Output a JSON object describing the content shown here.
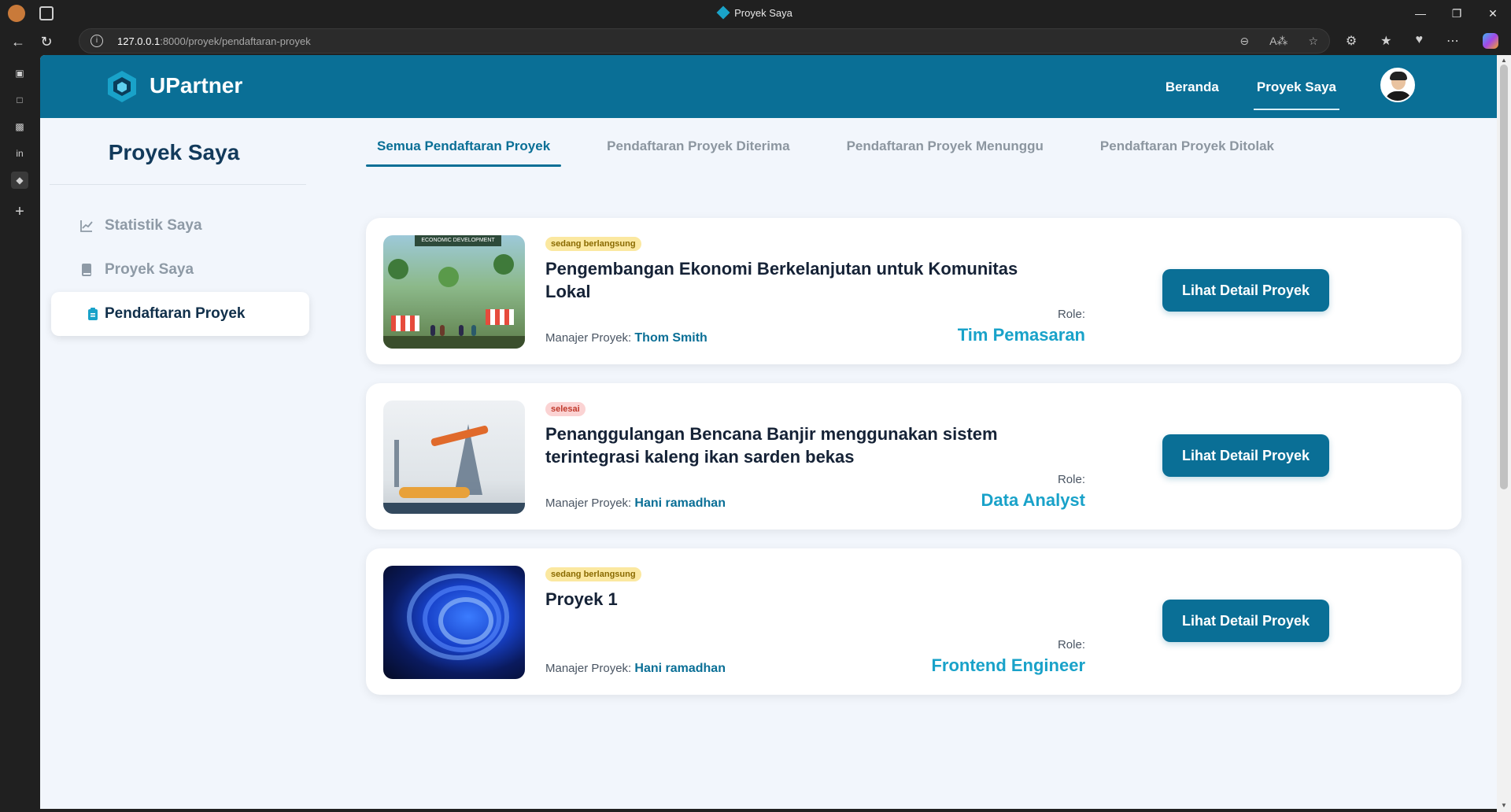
{
  "browser": {
    "tab_title": "Proyek Saya",
    "url_host": "127.0.0.1",
    "url_path": ":8000/proyek/pendaftaran-proyek"
  },
  "header": {
    "brand": "UPartner",
    "nav": [
      {
        "label": "Beranda"
      },
      {
        "label": "Proyek Saya"
      }
    ]
  },
  "sidebar": {
    "title": "Proyek Saya",
    "items": [
      {
        "label": "Statistik Saya",
        "icon": "chart-line-icon"
      },
      {
        "label": "Proyek Saya",
        "icon": "book-icon"
      },
      {
        "label": "Pendaftaran Proyek",
        "icon": "clipboard-icon"
      }
    ]
  },
  "tabs": [
    {
      "label": "Semua Pendaftaran Proyek"
    },
    {
      "label": "Pendaftaran Proyek Diterima"
    },
    {
      "label": "Pendaftaran Proyek Menunggu"
    },
    {
      "label": "Pendaftaran Proyek Ditolak"
    }
  ],
  "projects": [
    {
      "status": "sedang berlangsung",
      "title": "Pengembangan Ekonomi Berkelanjutan untuk Komunitas Lokal",
      "manager_label": "Manajer Proyek:",
      "manager": "Thom Smith",
      "role_label": "Role:",
      "role": "Tim Pemasaran",
      "button": "Lihat Detail Proyek",
      "thumb_banner": "ECONOMIC DEVELOPMENT"
    },
    {
      "status": "selesai",
      "title": "Penanggulangan Bencana Banjir menggunakan sistem terintegrasi kaleng ikan sarden bekas",
      "manager_label": "Manajer Proyek:",
      "manager": "Hani ramadhan",
      "role_label": "Role:",
      "role": "Data Analyst",
      "button": "Lihat Detail Proyek"
    },
    {
      "status": "sedang berlangsung",
      "title": "Proyek 1",
      "manager_label": "Manajer Proyek:",
      "manager": "Hani ramadhan",
      "role_label": "Role:",
      "role": "Frontend Engineer",
      "button": "Lihat Detail Proyek"
    }
  ],
  "colors": {
    "primary": "#0a6f96",
    "accent": "#19a2c9",
    "page_bg": "#f2f6fc",
    "badge_ongoing": "#fbe8a0",
    "badge_done": "#fbd3d3"
  }
}
